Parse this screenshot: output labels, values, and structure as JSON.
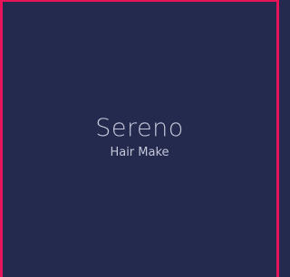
{
  "brand": {
    "name": "Sereno",
    "subtitle": "Hair Make"
  },
  "colors": {
    "background": "#24294e",
    "border": "#e8145a",
    "text": "#c3c7d8"
  }
}
